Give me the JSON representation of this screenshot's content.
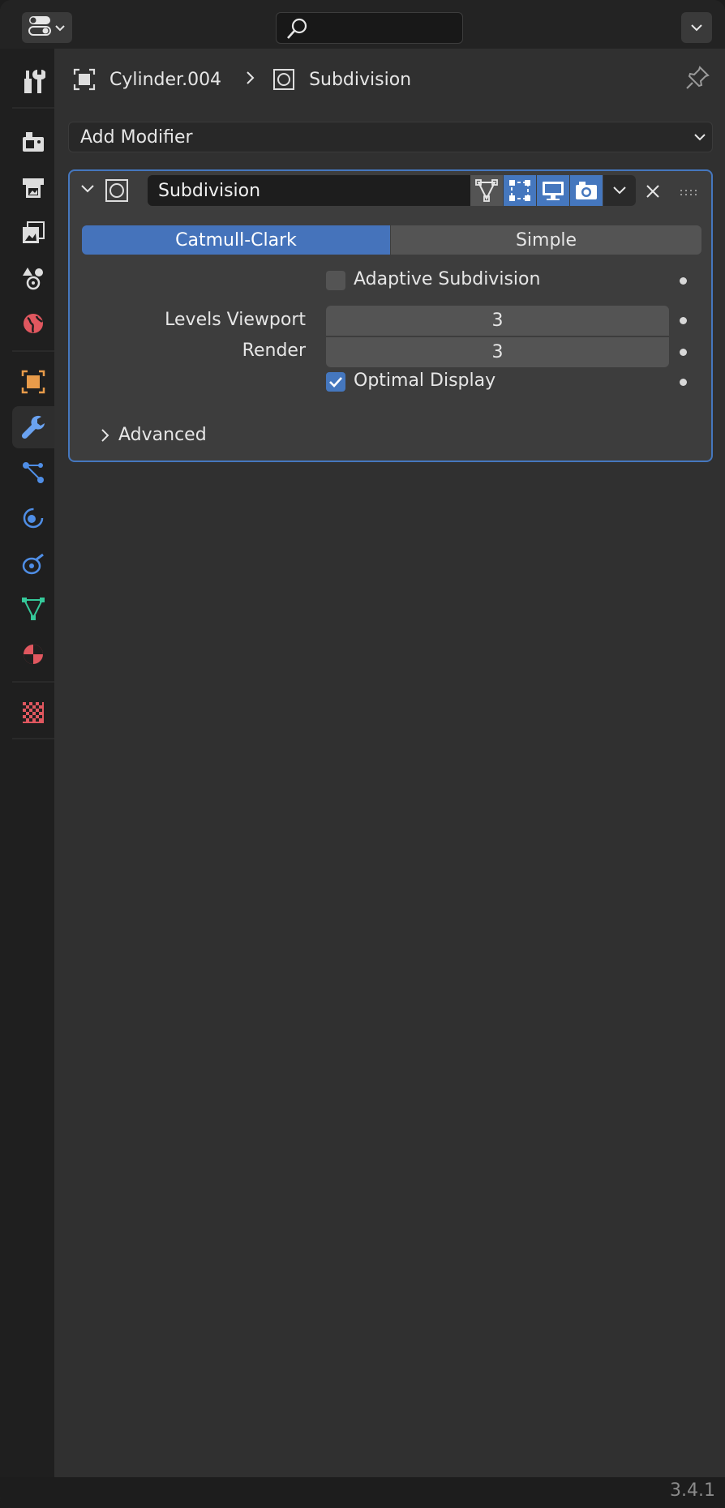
{
  "header": {
    "editor_type_icon": "properties-editor-icon",
    "search_placeholder": "",
    "menu_icon": "chevron-down-icon"
  },
  "tabs": [
    {
      "name": "tool",
      "icon": "tool-icon",
      "color": "#dddddd",
      "active": false
    },
    {
      "name": "render",
      "icon": "render-icon",
      "color": "#dddddd",
      "active": false
    },
    {
      "name": "output",
      "icon": "output-icon",
      "color": "#dddddd",
      "active": false
    },
    {
      "name": "view-layer",
      "icon": "view-layer-icon",
      "color": "#dddddd",
      "active": false
    },
    {
      "name": "scene",
      "icon": "scene-icon",
      "color": "#dddddd",
      "active": false
    },
    {
      "name": "world",
      "icon": "world-icon",
      "color": "#e0575f",
      "active": false
    },
    {
      "name": "object",
      "icon": "object-icon",
      "color": "#e89b4a",
      "active": false
    },
    {
      "name": "modifiers",
      "icon": "wrench-icon",
      "color": "#6aa2f0",
      "active": true
    },
    {
      "name": "particles",
      "icon": "particles-icon",
      "color": "#4f8ee6",
      "active": false
    },
    {
      "name": "physics",
      "icon": "physics-icon",
      "color": "#4f8ee6",
      "active": false
    },
    {
      "name": "constraints",
      "icon": "constraints-icon",
      "color": "#4f8ee6",
      "active": false
    },
    {
      "name": "data",
      "icon": "mesh-data-icon",
      "color": "#35c99a",
      "active": false
    },
    {
      "name": "material",
      "icon": "material-icon",
      "color": "#e0575f",
      "active": false
    },
    {
      "name": "texture",
      "icon": "texture-icon",
      "color": "#e0575f",
      "active": false
    }
  ],
  "breadcrumb": {
    "object_name": "Cylinder.004",
    "modifier_name": "Subdivision"
  },
  "add_modifier_label": "Add Modifier",
  "modifier": {
    "name": "Subdivision",
    "toggles": {
      "on_cage": false,
      "edit_mode": true,
      "viewport": true,
      "render": true
    },
    "algorithm_options": [
      "Catmull-Clark",
      "Simple"
    ],
    "algorithm_selected": "Catmull-Clark",
    "adaptive_label": "Adaptive Subdivision",
    "adaptive_checked": false,
    "levels_viewport_label": "Levels Viewport",
    "levels_viewport_value": "3",
    "render_label": "Render",
    "render_value": "3",
    "optimal_display_label": "Optimal Display",
    "optimal_display_checked": true,
    "advanced_label": "Advanced"
  },
  "colors": {
    "accent": "#4577be",
    "panel_bg": "#3d3d3d",
    "main_bg": "#303030"
  },
  "version": "3.4.1"
}
